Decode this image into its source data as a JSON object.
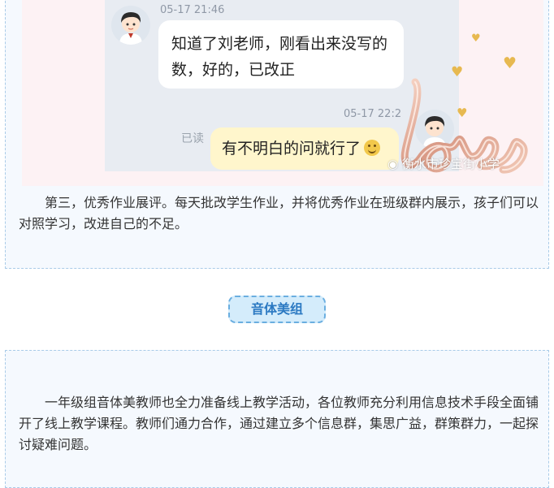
{
  "chat": {
    "incoming": {
      "timestamp": "05-17 21:46",
      "text": "知道了刘老师，刚看出来没写的数，好的，已改正"
    },
    "outgoing": {
      "timestamp": "05-17 22:2",
      "read_status": "已读",
      "text": "有不明白的问就行了"
    }
  },
  "decoration": {
    "balloon_word": "love",
    "watermark": "衡水市珍宝街小学"
  },
  "section1": {
    "paragraph": "第三，优秀作业展评。每天批改学生作业，并将优秀作业在班级群内展示，孩子们可以对照学习，改进自己的不足。"
  },
  "section2": {
    "title": "音体美组",
    "paragraph": "一年级组音体美教师也全力准备线上教学活动，各位教师充分利用信息技术手段全面铺开了线上教学课程。教师们通力合作，通过建立多个信息群，集思广益，群策群力，一起探讨疑难问题。"
  },
  "colors": {
    "card_background": "#f5f9fe",
    "card_border": "#a9cbe8",
    "pill_background": "#d4ecfb",
    "pill_text": "#2b79c2",
    "outgoing_bubble": "#fff6cc",
    "heart_gold": "#e7b950"
  },
  "icons": [
    "avatar-icon",
    "smiley-emoji-icon",
    "heart-icon",
    "wechat-icon"
  ]
}
